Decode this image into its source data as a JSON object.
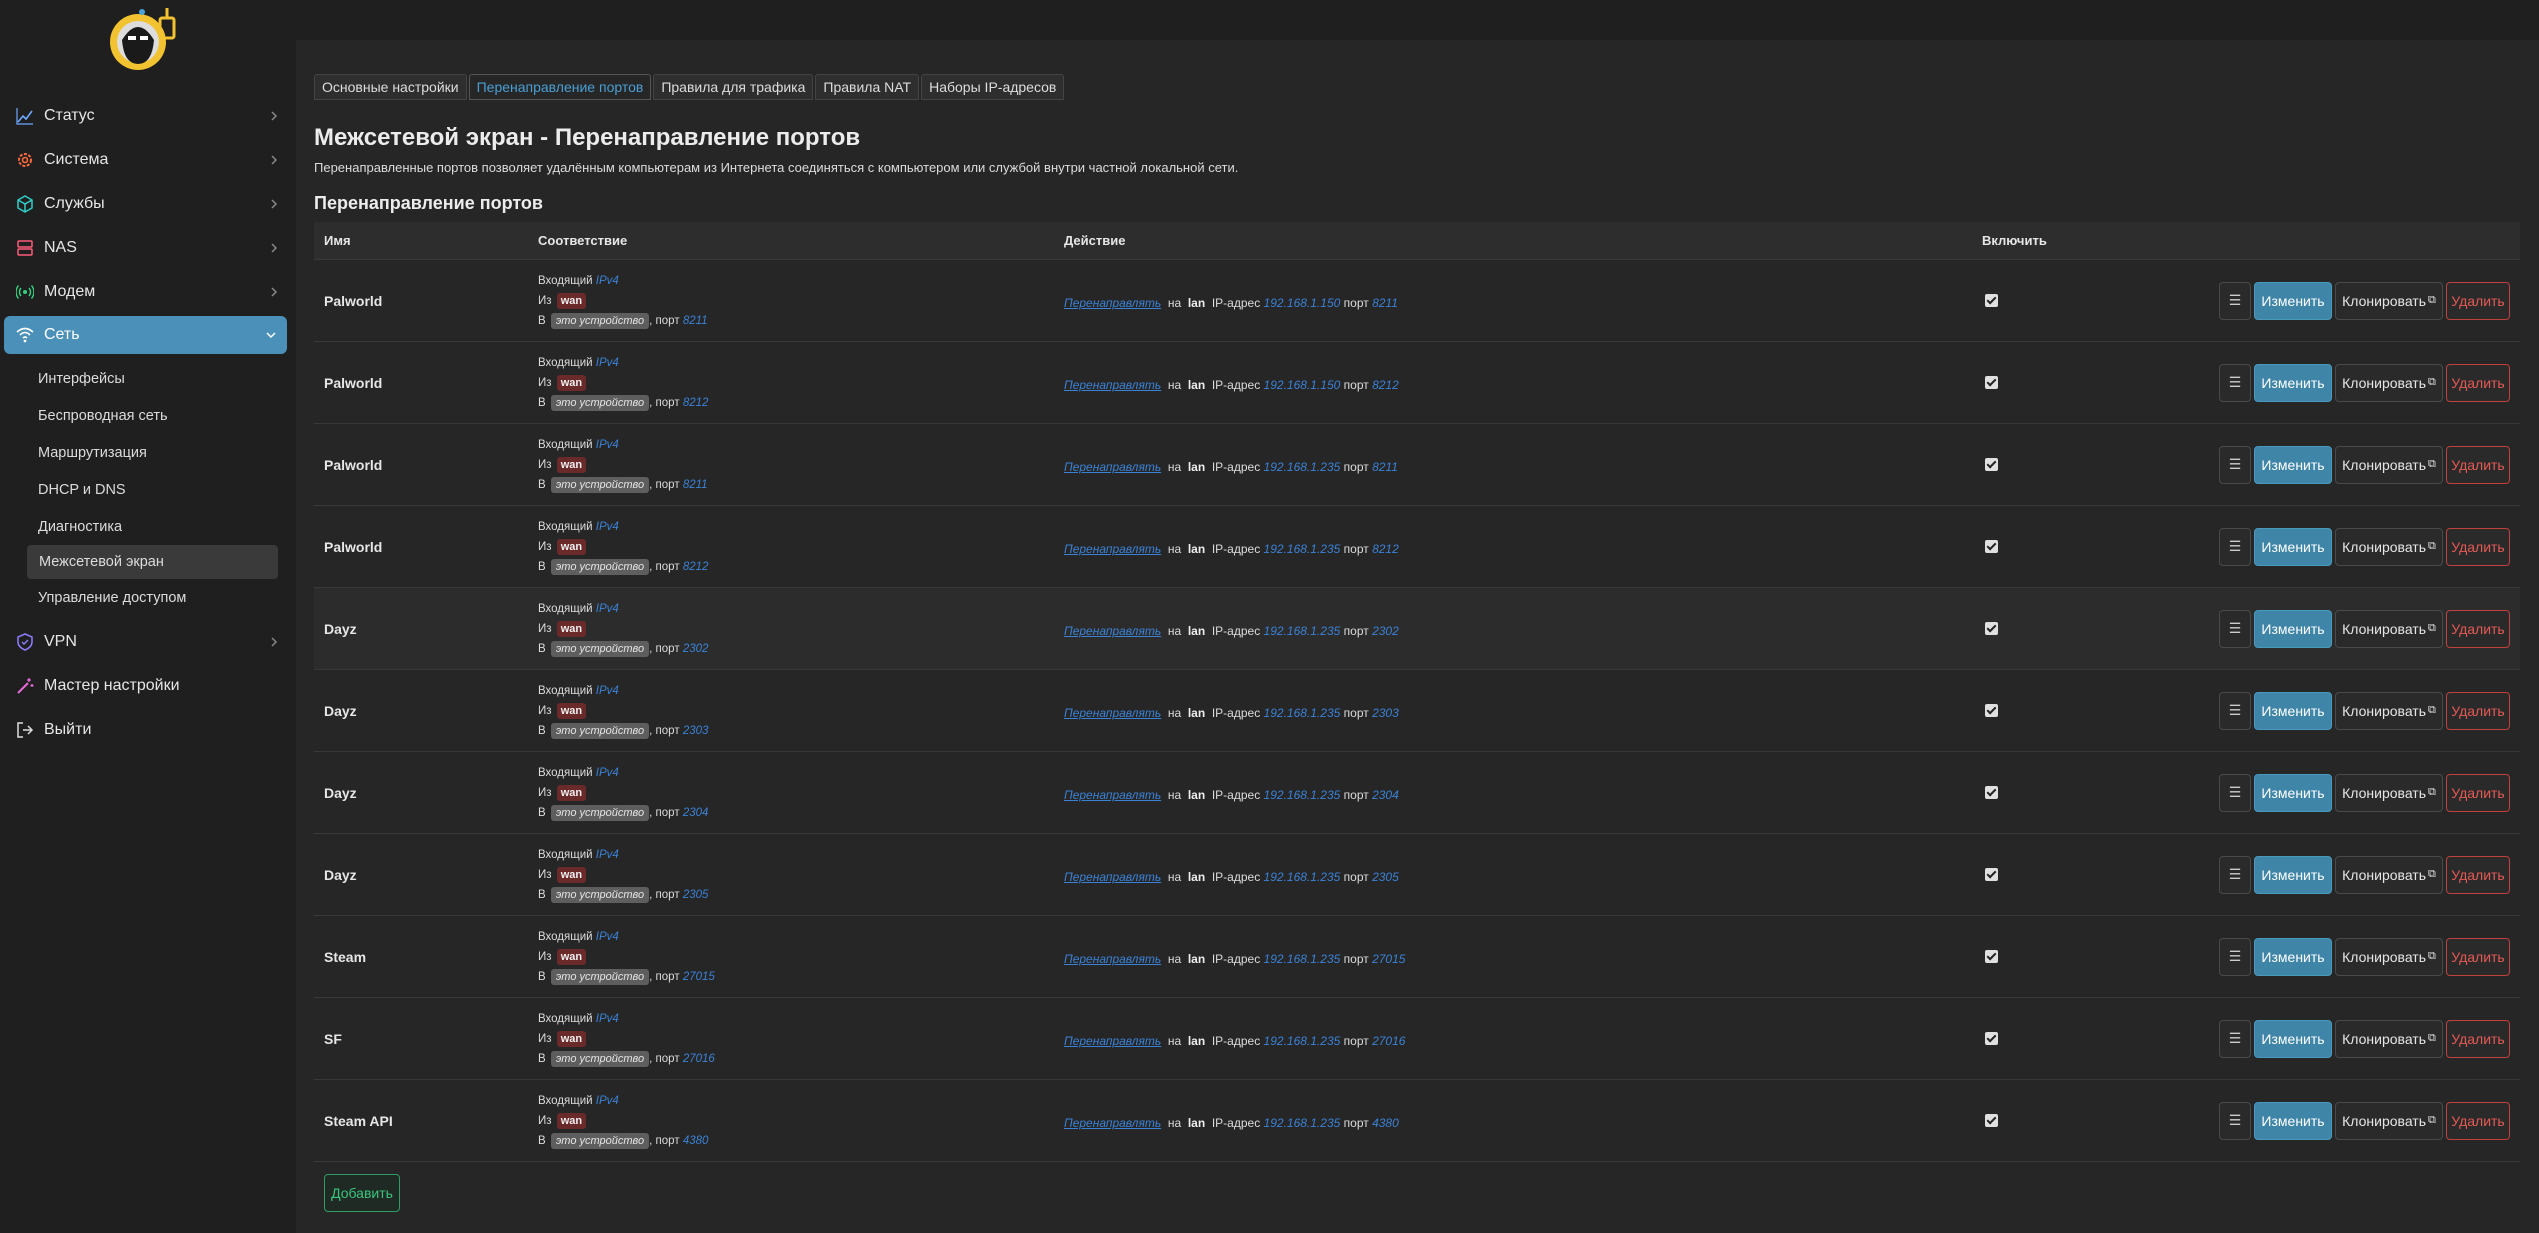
{
  "sidebar": {
    "items": [
      {
        "label": "Статус",
        "icon": "chart-icon"
      },
      {
        "label": "Система",
        "icon": "gear-icon"
      },
      {
        "label": "Службы",
        "icon": "cube-icon"
      },
      {
        "label": "NAS",
        "icon": "storage-icon"
      },
      {
        "label": "Модем",
        "icon": "signal-icon"
      },
      {
        "label": "Сеть",
        "icon": "wifi-icon"
      }
    ],
    "sub": [
      "Интерфейсы",
      "Беспроводная сеть",
      "Маршрутизация",
      "DHCP и DNS",
      "Диагностика",
      "Межсетевой экран",
      "Управление доступом"
    ],
    "items2": [
      {
        "label": "VPN",
        "icon": "shield-icon"
      },
      {
        "label": "Мастер настройки",
        "icon": "wand-icon"
      },
      {
        "label": "Выйти",
        "icon": "logout-icon"
      }
    ]
  },
  "tabs": [
    "Основные настройки",
    "Перенаправление портов",
    "Правила для трафика",
    "Правила NAT",
    "Наборы IP-адресов"
  ],
  "page": {
    "title": "Межсетевой экран - Перенаправление портов",
    "desc": "Перенаправленные портов позволяет удалённым компьютерам из Интернета соединяться с компьютером или службой внутри частной локальной сети.",
    "section": "Перенаправление портов"
  },
  "table": {
    "headers": {
      "name": "Имя",
      "match": "Соответствие",
      "action": "Действие",
      "enable": "Включить"
    },
    "labels": {
      "incoming": "Входящий",
      "ipv4": "IPv4",
      "from": "Из",
      "wan": "wan",
      "to": "В",
      "device": "это устройство",
      "port_sep": ", порт",
      "redirect": "Перенаправлять",
      "on": "на",
      "lan": "lan",
      "ip": "IP-адрес",
      "port": "порт",
      "menu": "☰",
      "edit": "Изменить",
      "clone": "Клонировать",
      "clone_icon": "⧉",
      "delete": "Удалить"
    },
    "rows": [
      {
        "name": "Palworld",
        "ext_port": "8211",
        "ip": "192.168.1.150",
        "int_port": "8211"
      },
      {
        "name": "Palworld",
        "ext_port": "8212",
        "ip": "192.168.1.150",
        "int_port": "8212"
      },
      {
        "name": "Palworld",
        "ext_port": "8211",
        "ip": "192.168.1.235",
        "int_port": "8211"
      },
      {
        "name": "Palworld",
        "ext_port": "8212",
        "ip": "192.168.1.235",
        "int_port": "8212"
      },
      {
        "name": "Dayz",
        "ext_port": "2302",
        "ip": "192.168.1.235",
        "int_port": "2302"
      },
      {
        "name": "Dayz",
        "ext_port": "2303",
        "ip": "192.168.1.235",
        "int_port": "2303"
      },
      {
        "name": "Dayz",
        "ext_port": "2304",
        "ip": "192.168.1.235",
        "int_port": "2304"
      },
      {
        "name": "Dayz",
        "ext_port": "2305",
        "ip": "192.168.1.235",
        "int_port": "2305"
      },
      {
        "name": "Steam",
        "ext_port": "27015",
        "ip": "192.168.1.235",
        "int_port": "27015"
      },
      {
        "name": "SF",
        "ext_port": "27016",
        "ip": "192.168.1.235",
        "int_port": "27016"
      },
      {
        "name": "Steam API",
        "ext_port": "4380",
        "ip": "192.168.1.235",
        "int_port": "4380"
      }
    ],
    "add": "Добавить"
  }
}
